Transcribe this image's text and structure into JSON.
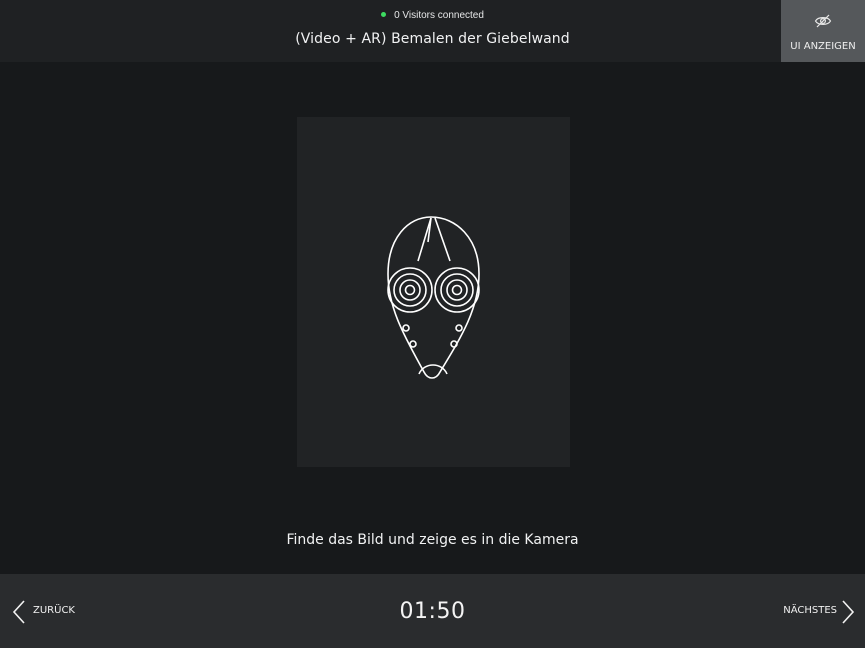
{
  "header": {
    "visitors_text": "0 Visitors connected",
    "status_color": "#3ddc61",
    "title": "(Video + AR) Bemalen der Giebelwand",
    "show_ui_label": "UI ANZEIGEN",
    "show_ui_icon": "eye-slash-icon"
  },
  "content": {
    "marker_image": "mask-marker-image",
    "instruction": "Finde das Bild und zeige es in die Kamera"
  },
  "footer": {
    "back_label": "ZURÜCK",
    "back_icon": "chevron-left-icon",
    "timer": "01:50",
    "next_label": "NÄCHSTES",
    "next_icon": "chevron-right-icon"
  },
  "colors": {
    "background": "#17191b",
    "header_bg": "#1f2123",
    "footer_bg": "#2a2c2e",
    "button_bg": "#55585b",
    "card_bg": "#212325"
  }
}
